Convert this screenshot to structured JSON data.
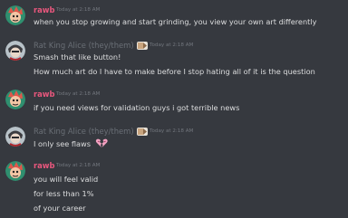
{
  "messages": [
    {
      "author": "rawb",
      "timestamp": "Today at 2:18 AM",
      "lines": [
        "when you stop growing and start grinding, you view your own art differently"
      ]
    },
    {
      "author": "Rat King Alice (they/them)",
      "timestamp": "Today at 2:18 AM",
      "lines": [
        "Smash that like button!",
        "How much art do I have to make before I stop hating all of it is the question"
      ]
    },
    {
      "author": "rawb",
      "timestamp": "Today at 2:18 AM",
      "lines": [
        "if you need views for validation guys i got terrible news"
      ]
    },
    {
      "author": "Rat King Alice (they/them)",
      "timestamp": "Today at 2:18 AM",
      "lines": [
        "I only see flaws"
      ]
    },
    {
      "author": "rawb",
      "timestamp": "Today at 2:18 AM",
      "lines": [
        "you will feel valid",
        "for less than 1%",
        "of your career"
      ]
    }
  ],
  "colors": {
    "background": "#36393f",
    "rawb_name": "#e9577d",
    "alice_name": "#6a6f76",
    "text": "#dcddde",
    "timestamp": "#72767d"
  },
  "icons": {
    "alice_badge": "tag-badge-icon",
    "flaws_emoji": "broken-heart-emoji-icon"
  }
}
